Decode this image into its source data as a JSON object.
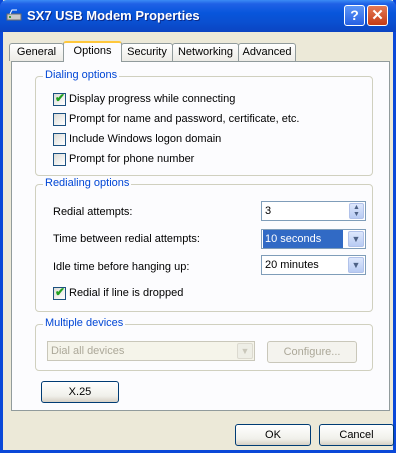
{
  "window": {
    "title": "SX7 USB Modem Properties",
    "help_glyph": "?",
    "close_glyph": "✕"
  },
  "tabs": [
    {
      "label": "General"
    },
    {
      "label": "Options",
      "active": true
    },
    {
      "label": "Security"
    },
    {
      "label": "Networking"
    },
    {
      "label": "Advanced"
    }
  ],
  "dialing": {
    "title": "Dialing options",
    "options": [
      {
        "label": "Display progress while connecting",
        "checked": true
      },
      {
        "label": "Prompt for name and password, certificate, etc.",
        "checked": false
      },
      {
        "label": "Include Windows logon domain",
        "checked": false
      },
      {
        "label": "Prompt for phone number",
        "checked": false
      }
    ]
  },
  "redialing": {
    "title": "Redialing options",
    "attempts_label": "Redial attempts:",
    "attempts_value": "3",
    "between_label": "Time between redial attempts:",
    "between_value": "10 seconds",
    "idle_label": "Idle time before hanging up:",
    "idle_value": "20 minutes",
    "redial_if_dropped_label": "Redial if line is dropped",
    "redial_if_dropped_checked": true
  },
  "multiple": {
    "title": "Multiple devices",
    "dial_value": "Dial all devices",
    "configure_label": "Configure..."
  },
  "x25_label": "X.25",
  "footer": {
    "ok_label": "OK",
    "cancel_label": "Cancel"
  },
  "colors": {
    "title_bar": "#0a4fd0",
    "group_label": "#0046d5",
    "selection": "#316ac5",
    "check_mark": "#21a121"
  },
  "icons": {
    "title": "modem-icon",
    "tick": "check-mark-icon",
    "combo": "chevron-down-icon",
    "spin": "spin-arrows-icon"
  }
}
